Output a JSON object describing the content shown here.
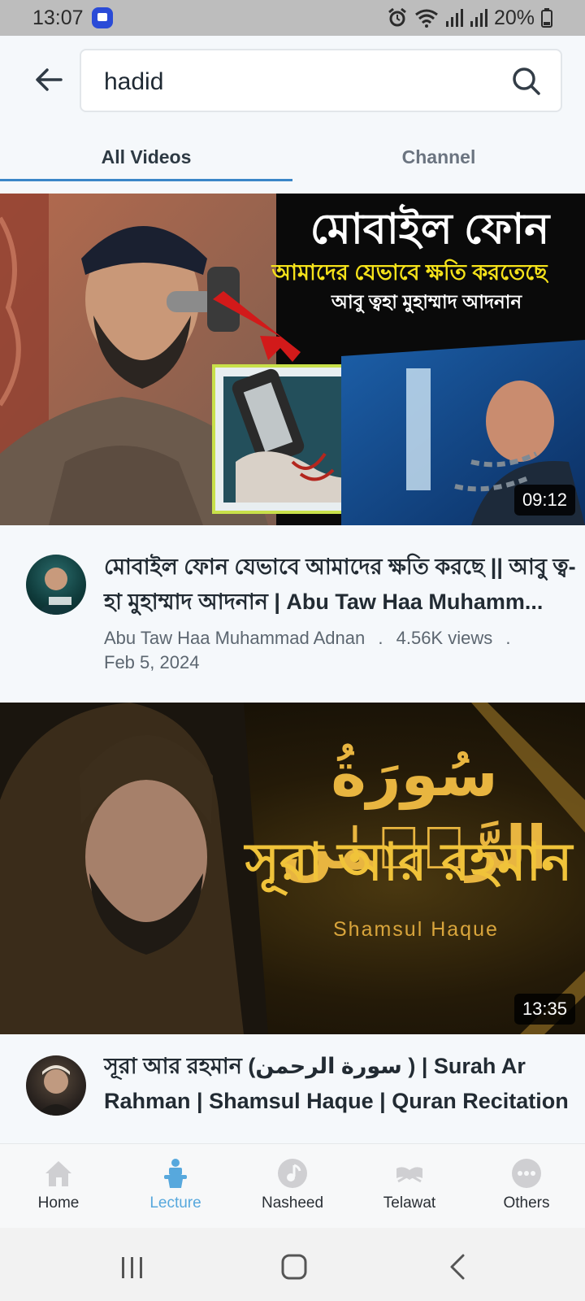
{
  "status_bar": {
    "time": "13:07",
    "battery": "20%"
  },
  "search": {
    "query": "hadid"
  },
  "tabs": [
    {
      "label": "All Videos",
      "active": true
    },
    {
      "label": "Channel",
      "active": false
    }
  ],
  "videos": [
    {
      "title": "মোবাইল ফোন যেভাবে আমাদের ক্ষতি করছে || আবু ত্ব-হা মুহাম্মাদ আদনান | Abu Taw Haa Muhamm...",
      "channel": "Abu Taw Haa Muhammad Adnan",
      "views": "4.56K views",
      "date": "Feb 5, 2024",
      "duration": "09:12",
      "thumb_text_1": "মোবাইল ফোন",
      "thumb_text_2": "আমাদের যেভাবে ক্ষতি করতেছে",
      "thumb_text_3": "আবু ত্বহা মুহাম্মাদ আদনান"
    },
    {
      "title": "সূরা আর রহমান (سورة الرحمن ) | Surah Ar Rahman | Shamsul Haque | Quran Recitation",
      "duration": "13:35",
      "thumb_text_1": "سُورَةُ الرَّحۡمٰن",
      "thumb_text_2": "সূরা আর রহমান",
      "thumb_text_3": "Shamsul Haque"
    }
  ],
  "meta_separator": ".",
  "bottom_nav": [
    {
      "label": "Home",
      "icon": "home-icon",
      "active": false
    },
    {
      "label": "Lecture",
      "icon": "lecture-icon",
      "active": true
    },
    {
      "label": "Nasheed",
      "icon": "nasheed-icon",
      "active": false
    },
    {
      "label": "Telawat",
      "icon": "telawat-icon",
      "active": false
    },
    {
      "label": "Others",
      "icon": "others-icon",
      "active": false
    }
  ],
  "colors": {
    "accent": "#3a86c8",
    "active_nav": "#57a8dd"
  }
}
